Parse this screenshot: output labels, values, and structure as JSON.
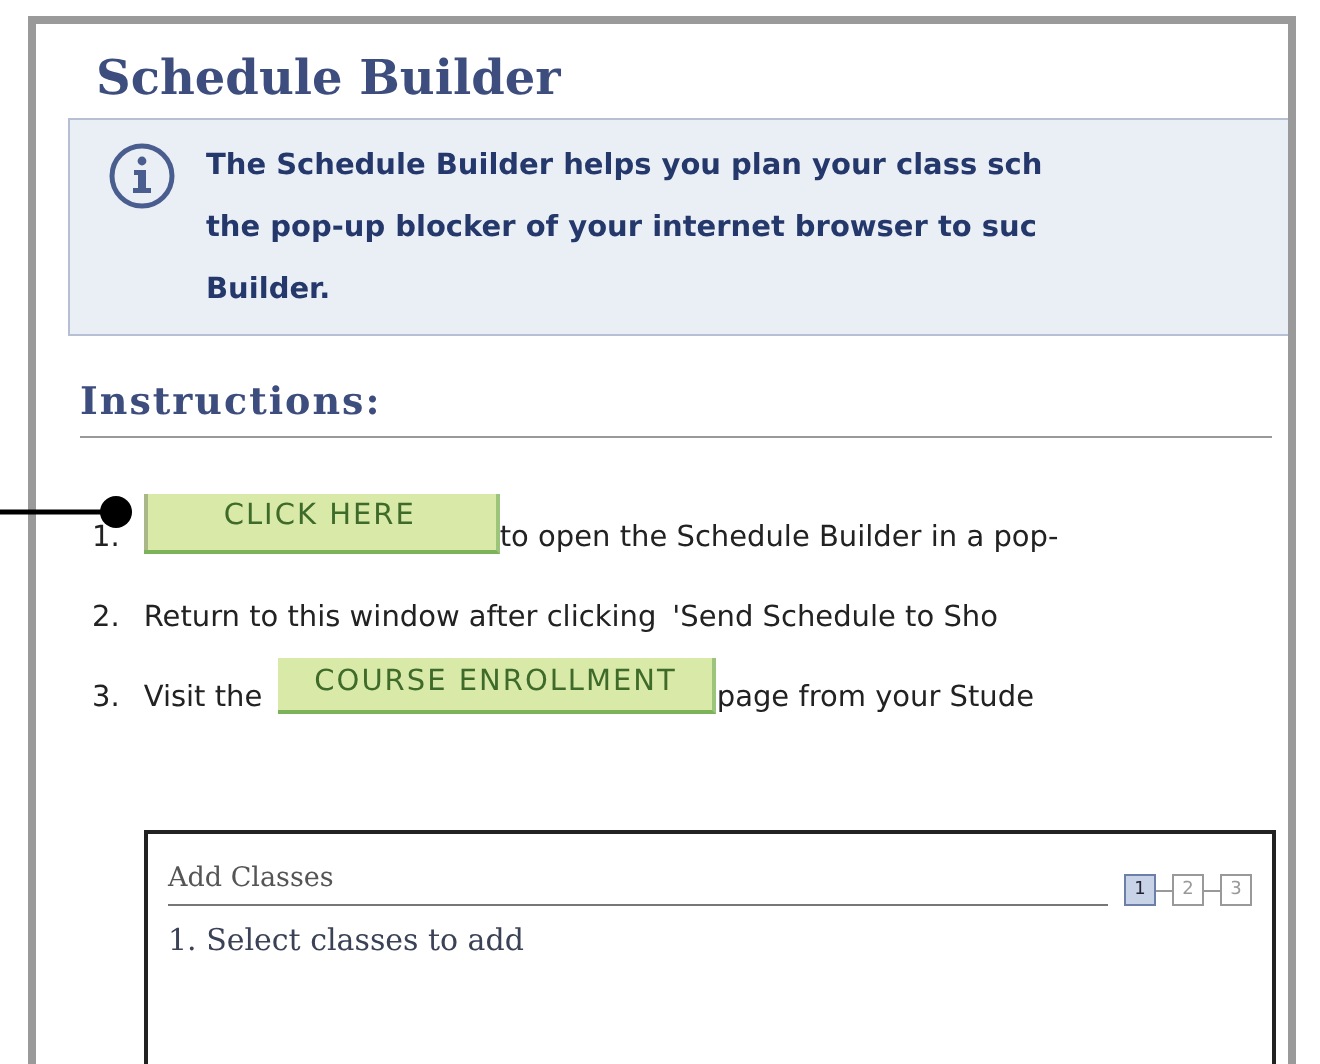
{
  "title": "Schedule Builder",
  "info": {
    "lines": [
      "The Schedule Builder helps you plan your class sch",
      "the pop-up blocker of your internet browser to suc",
      "Builder."
    ]
  },
  "instructions": {
    "heading": "Instructions:",
    "steps": [
      {
        "number": "1.",
        "parts": [
          {
            "kind": "button",
            "text": "CLICK HERE"
          },
          {
            "kind": "text",
            "text": "to open the Schedule Builder in a pop-"
          }
        ]
      },
      {
        "number": "2.",
        "parts": [
          {
            "kind": "text",
            "text": "Return to this window after clicking"
          },
          {
            "kind": "text",
            "text": "'Send Schedule to Sho"
          }
        ]
      },
      {
        "number": "3.",
        "parts": [
          {
            "kind": "text",
            "text": "Visit the"
          },
          {
            "kind": "button",
            "text": "COURSE ENROLLMENT"
          },
          {
            "kind": "text",
            "text": "page from your Stude"
          }
        ]
      }
    ]
  },
  "add_classes": {
    "title": "Add Classes",
    "steps": [
      {
        "label": "1",
        "selected": true
      },
      {
        "label": "2",
        "selected": false
      },
      {
        "label": "3",
        "selected": false
      }
    ],
    "subtitle": "1.  Select classes to add"
  }
}
